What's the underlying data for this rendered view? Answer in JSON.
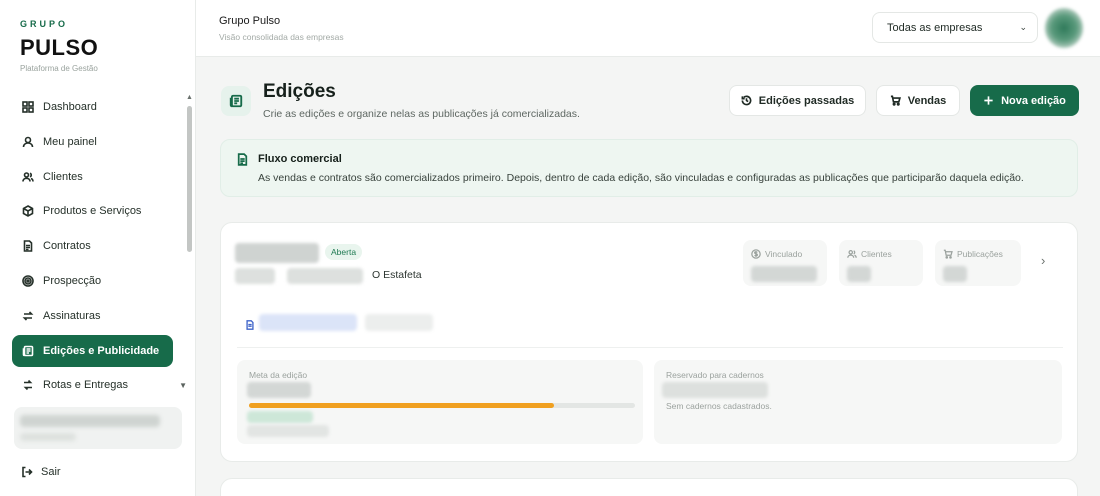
{
  "brand": {
    "kicker": "GRUPO",
    "name": "PULSO",
    "subtitle": "Plataforma de Gestão"
  },
  "sidebar": {
    "items": [
      {
        "label": "Dashboard",
        "icon": "grid-icon",
        "active": false
      },
      {
        "label": "Meu painel",
        "icon": "user-icon",
        "active": false
      },
      {
        "label": "Clientes",
        "icon": "users-icon",
        "active": false
      },
      {
        "label": "Produtos e Serviços",
        "icon": "package-icon",
        "active": false
      },
      {
        "label": "Contratos",
        "icon": "document-icon",
        "active": false
      },
      {
        "label": "Prospecção",
        "icon": "target-icon",
        "active": false
      },
      {
        "label": "Assinaturas",
        "icon": "repeat-icon",
        "active": false
      },
      {
        "label": "Edições e Publicidade",
        "icon": "newspaper-icon",
        "active": true
      },
      {
        "label": "Rotas e Entregas",
        "icon": "route-icon",
        "active": false
      }
    ],
    "logout_label": "Sair"
  },
  "topbar": {
    "title": "Grupo Pulso",
    "subtitle": "Visão consolidada das empresas",
    "company_select": "Todas as empresas"
  },
  "header": {
    "title": "Edições",
    "description": "Crie as edições e organize nelas as publicações já comercializadas.",
    "buttons": {
      "past": "Edições passadas",
      "sales": "Vendas",
      "new": "Nova edição"
    }
  },
  "banner": {
    "title": "Fluxo comercial",
    "text": "As vendas e contratos são comercializados primeiro. Depois, dentro de cada edição, são vinculadas e configuradas as publicações que participarão daquela edição."
  },
  "edition_card": {
    "status": "Aberta",
    "location": "O Estafeta",
    "stats": {
      "linked_label": "Vinculado",
      "clients_label": "Clientes",
      "publications_label": "Publicações"
    },
    "goal_label": "Meta da edição",
    "goal_progress": 0.79,
    "reserved_label": "Reservado para cadernos",
    "reserved_empty": "Sem cadernos cadastrados."
  },
  "colors": {
    "brand_green": "#176b4a",
    "progress": "#f0a020",
    "badge_bg": "#e9f5ee"
  }
}
